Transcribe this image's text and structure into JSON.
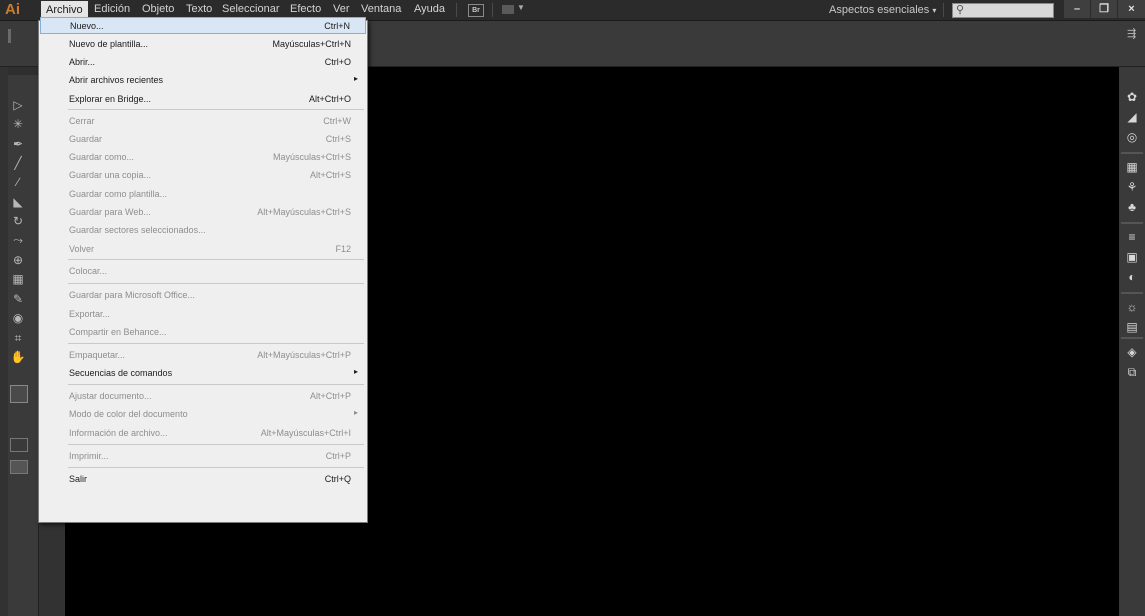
{
  "app": {
    "logo": "Ai"
  },
  "menubar": {
    "items": [
      "Archivo",
      "Edición",
      "Objeto",
      "Texto",
      "Seleccionar",
      "Efecto",
      "Ver",
      "Ventana",
      "Ayuda"
    ],
    "bridge_label": "Br",
    "workspace_label": "Aspectos esenciales",
    "workspace_caret": "▾",
    "search_icon": "⚲"
  },
  "window_buttons": {
    "minimize": "–",
    "restore": "❐",
    "close": "×"
  },
  "file_menu": {
    "items": [
      {
        "label": "Nuevo...",
        "shortcut": "Ctrl+N",
        "enabled": true,
        "highlighted": true
      },
      {
        "label": "Nuevo de plantilla...",
        "shortcut": "Mayúsculas+Ctrl+N",
        "enabled": true
      },
      {
        "label": "Abrir...",
        "shortcut": "Ctrl+O",
        "enabled": true
      },
      {
        "label": "Abrir archivos recientes",
        "shortcut": "",
        "enabled": true,
        "submenu": true
      },
      {
        "label": "Explorar en Bridge...",
        "shortcut": "Alt+Ctrl+O",
        "enabled": true
      },
      {
        "label": "Cerrar",
        "shortcut": "Ctrl+W",
        "enabled": false
      },
      {
        "label": "Guardar",
        "shortcut": "Ctrl+S",
        "enabled": false
      },
      {
        "label": "Guardar como...",
        "shortcut": "Mayúsculas+Ctrl+S",
        "enabled": false
      },
      {
        "label": "Guardar una copia...",
        "shortcut": "Alt+Ctrl+S",
        "enabled": false
      },
      {
        "label": "Guardar como plantilla...",
        "shortcut": "",
        "enabled": false
      },
      {
        "label": "Guardar para Web...",
        "shortcut": "Alt+Mayúsculas+Ctrl+S",
        "enabled": false
      },
      {
        "label": "Guardar sectores seleccionados...",
        "shortcut": "",
        "enabled": false
      },
      {
        "label": "Volver",
        "shortcut": "F12",
        "enabled": false
      },
      {
        "label": "Colocar...",
        "shortcut": "",
        "enabled": false
      },
      {
        "label": "Guardar para Microsoft Office...",
        "shortcut": "",
        "enabled": false
      },
      {
        "label": "Exportar...",
        "shortcut": "",
        "enabled": false
      },
      {
        "label": "Compartir en Behance...",
        "shortcut": "",
        "enabled": false
      },
      {
        "label": "Empaquetar...",
        "shortcut": "Alt+Mayúsculas+Ctrl+P",
        "enabled": false
      },
      {
        "label": "Secuencias de comandos",
        "shortcut": "",
        "enabled": true,
        "submenu": true
      },
      {
        "label": "Ajustar documento...",
        "shortcut": "Alt+Ctrl+P",
        "enabled": false
      },
      {
        "label": "Modo de color del documento",
        "shortcut": "",
        "enabled": false,
        "submenu": true
      },
      {
        "label": "Información de archivo...",
        "shortcut": "Alt+Mayúsculas+Ctrl+I",
        "enabled": false
      },
      {
        "label": "Imprimir...",
        "shortcut": "Ctrl+P",
        "enabled": false
      },
      {
        "label": "Salir",
        "shortcut": "Ctrl+Q",
        "enabled": true
      }
    ],
    "submenu_arrow": "▸"
  },
  "tools": [
    "selection-tool",
    "magic-wand-tool",
    "pen-tool",
    "line-tool",
    "paintbrush-tool",
    "eraser-tool",
    "rotate-tool",
    "width-tool",
    "shape-builder-tool",
    "perspective-grid-tool",
    "eyedropper-tool",
    "symbol-sprayer-tool",
    "artboard-tool",
    "hand-tool"
  ],
  "tool_glyphs": [
    "▷",
    "✳",
    "✒",
    "╱",
    "∕",
    "◣",
    "↻",
    "⤳",
    "⊕",
    "▦",
    "✎",
    "◉",
    "⌗",
    "✋"
  ],
  "right_panel_icons": [
    "color-icon",
    "gradient-icon",
    "color-guide-icon",
    "swatches-icon",
    "brushes-icon",
    "symbols-icon",
    "stroke-icon",
    "gradient-panel-icon",
    "transparency-icon",
    "appearance-icon",
    "graphic-styles-icon",
    "layers-icon",
    "artboards-icon"
  ],
  "right_panel_glyphs": [
    "✿",
    "◢",
    "◎",
    "▦",
    "⚘",
    "♣",
    "≡",
    "▣",
    "◐",
    "☼",
    "▤",
    "◈",
    "⧉"
  ],
  "colors": {
    "accent": "#cd7b2e",
    "highlight": "#d9e6f6",
    "canvas": "#000000"
  }
}
